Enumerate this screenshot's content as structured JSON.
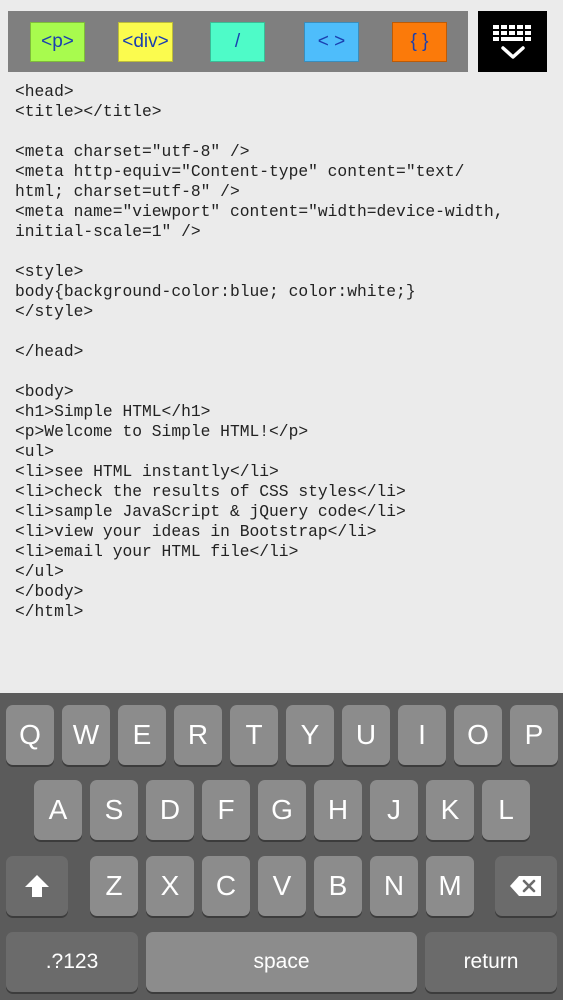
{
  "toolbar": {
    "buttons": [
      {
        "label": "<p>",
        "bg": "#a8fb4e",
        "fg": "#1a3fb0"
      },
      {
        "label": "<div>",
        "bg": "#fbfb4e",
        "fg": "#1a3fb0"
      },
      {
        "label": "/",
        "bg": "#4efbc8",
        "fg": "#1a3fb0"
      },
      {
        "label": "< >",
        "bg": "#4ebdfb",
        "fg": "#1a3fb0"
      },
      {
        "label": "{ }",
        "bg": "#fb7a0a",
        "fg": "#1a3fb0"
      }
    ],
    "keyboard_toggle_icon": "keyboard-dismiss-icon"
  },
  "editor": {
    "content": "<head>\n<title></title>\n\n<meta charset=\"utf-8\" />\n<meta http-equiv=\"Content-type\" content=\"text/\nhtml; charset=utf-8\" />\n<meta name=\"viewport\" content=\"width=device-width,\ninitial-scale=1\" />\n\n<style>\nbody{background-color:blue; color:white;}\n</style>\n\n</head>\n\n<body>\n<h1>Simple HTML</h1>\n<p>Welcome to Simple HTML!</p>\n<ul>\n<li>see HTML instantly</li>\n<li>check the results of CSS styles</li>\n<li>sample JavaScript & jQuery code</li>\n<li>view your ideas in Bootstrap</li>\n<li>email your HTML file</li>\n</ul>\n</body>\n</html>"
  },
  "keyboard": {
    "row1": [
      "Q",
      "W",
      "E",
      "R",
      "T",
      "Y",
      "U",
      "I",
      "O",
      "P"
    ],
    "row2": [
      "A",
      "S",
      "D",
      "F",
      "G",
      "H",
      "J",
      "K",
      "L"
    ],
    "row3": [
      "Z",
      "X",
      "C",
      "V",
      "B",
      "N",
      "M"
    ],
    "shift_icon": "shift-icon",
    "delete_icon": "backspace-icon",
    "numbers_label": ".?123",
    "space_label": "space",
    "return_label": "return"
  }
}
